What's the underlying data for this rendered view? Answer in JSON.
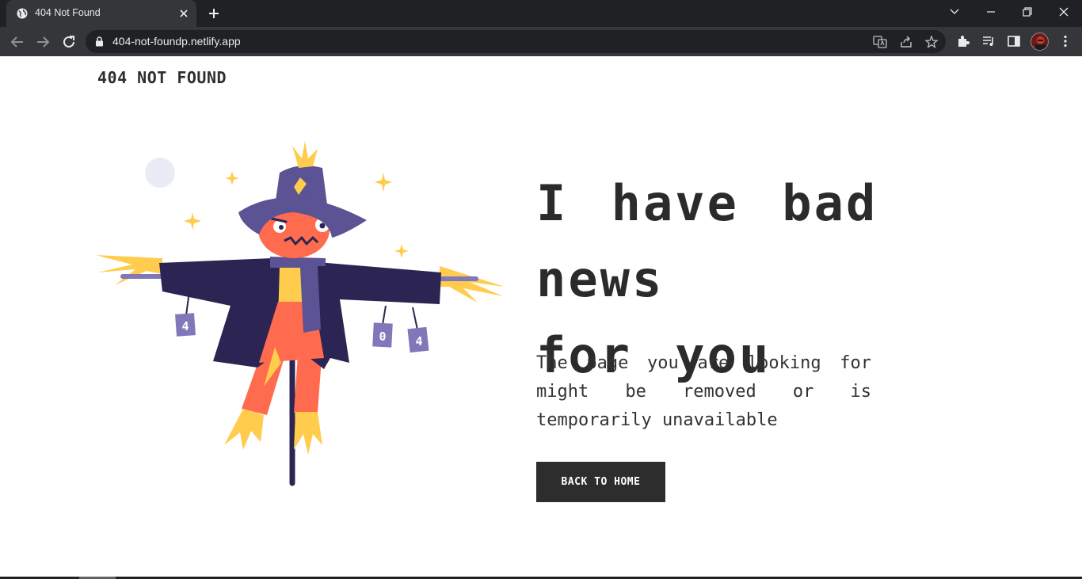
{
  "browser": {
    "tab_title": "404 Not Found",
    "url": "404-not-foundp.netlify.app"
  },
  "page": {
    "logo": "404 NOT FOUND",
    "headline_line1": "I have bad news",
    "headline_line2": "for you",
    "message": "The page you are looking for might be removed or is temporarily unavailable",
    "button_label": "BACK TO HOME",
    "cans": [
      "4",
      "0",
      "4"
    ]
  },
  "colors": {
    "hat": "#5b5393",
    "coat": "#2c2553",
    "face": "#ff6b4f",
    "straw": "#ffcc4d",
    "moon": "#e9ebf6",
    "button_bg": "#2d2d2d",
    "text": "#2b2b2b"
  }
}
